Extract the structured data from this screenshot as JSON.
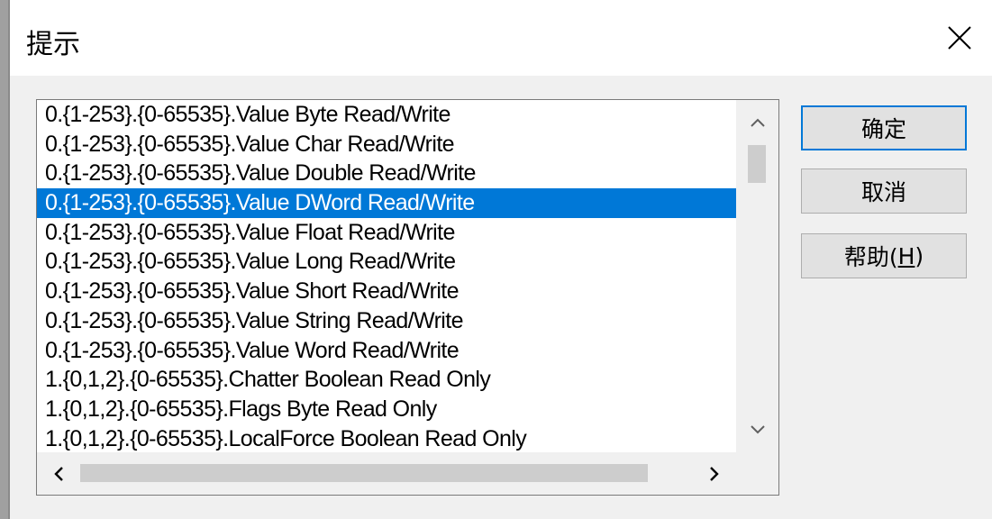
{
  "dialog": {
    "title": "提示",
    "close_icon": "close-icon"
  },
  "list": {
    "selected_index": 3,
    "items": [
      "0.{1-253}.{0-65535}.Value Byte Read/Write",
      "0.{1-253}.{0-65535}.Value Char Read/Write",
      "0.{1-253}.{0-65535}.Value Double Read/Write",
      "0.{1-253}.{0-65535}.Value DWord Read/Write",
      "0.{1-253}.{0-65535}.Value Float Read/Write",
      "0.{1-253}.{0-65535}.Value Long Read/Write",
      "0.{1-253}.{0-65535}.Value Short Read/Write",
      "0.{1-253}.{0-65535}.Value String Read/Write",
      "0.{1-253}.{0-65535}.Value Word Read/Write",
      "1.{0,1,2}.{0-65535}.Chatter Boolean Read Only",
      "1.{0,1,2}.{0-65535}.Flags Byte Read Only",
      "1.{0,1,2}.{0-65535}.LocalForce Boolean Read Only"
    ]
  },
  "buttons": {
    "ok": "确定",
    "cancel": "取消",
    "help": "帮助(",
    "help_mnemonic": "H",
    "help_close": ")"
  },
  "colors": {
    "selection": "#0078d7",
    "dialog_bg": "#f0f0f0"
  }
}
